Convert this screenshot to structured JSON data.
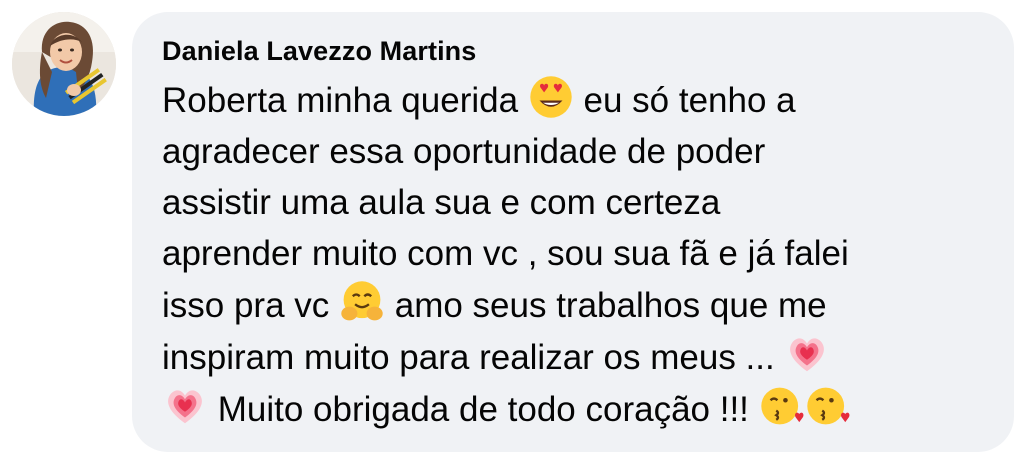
{
  "comment": {
    "author": "Daniela Lavezzo Martins",
    "avatar_icon": "profile-photo",
    "lines": [
      {
        "segments": [
          {
            "text": "Roberta minha querida "
          },
          {
            "emoji": "heart-eyes-emoji"
          },
          {
            "text": " eu só tenho a"
          }
        ]
      },
      {
        "segments": [
          {
            "text": "agradecer essa oportunidade de poder"
          }
        ]
      },
      {
        "segments": [
          {
            "text": "assistir uma aula sua e com certeza"
          }
        ]
      },
      {
        "segments": [
          {
            "text": "aprender muito com vc , sou sua fã e já falei"
          }
        ]
      },
      {
        "segments": [
          {
            "text": "isso pra vc "
          },
          {
            "emoji": "hugging-face-emoji"
          },
          {
            "text": " amo seus trabalhos que me"
          }
        ]
      },
      {
        "segments": [
          {
            "text": "inspiram muito para realizar os meus ... "
          },
          {
            "emoji": "growing-heart-emoji"
          }
        ]
      },
      {
        "segments": [
          {
            "emoji": "growing-heart-emoji"
          },
          {
            "text": " Muito obrigada de todo coração !!! "
          },
          {
            "emoji": "kissing-face-emoji"
          },
          {
            "emoji": "kissing-face-emoji"
          }
        ]
      }
    ]
  },
  "colors": {
    "bubble_bg": "#f0f2f5",
    "text": "#050505"
  }
}
